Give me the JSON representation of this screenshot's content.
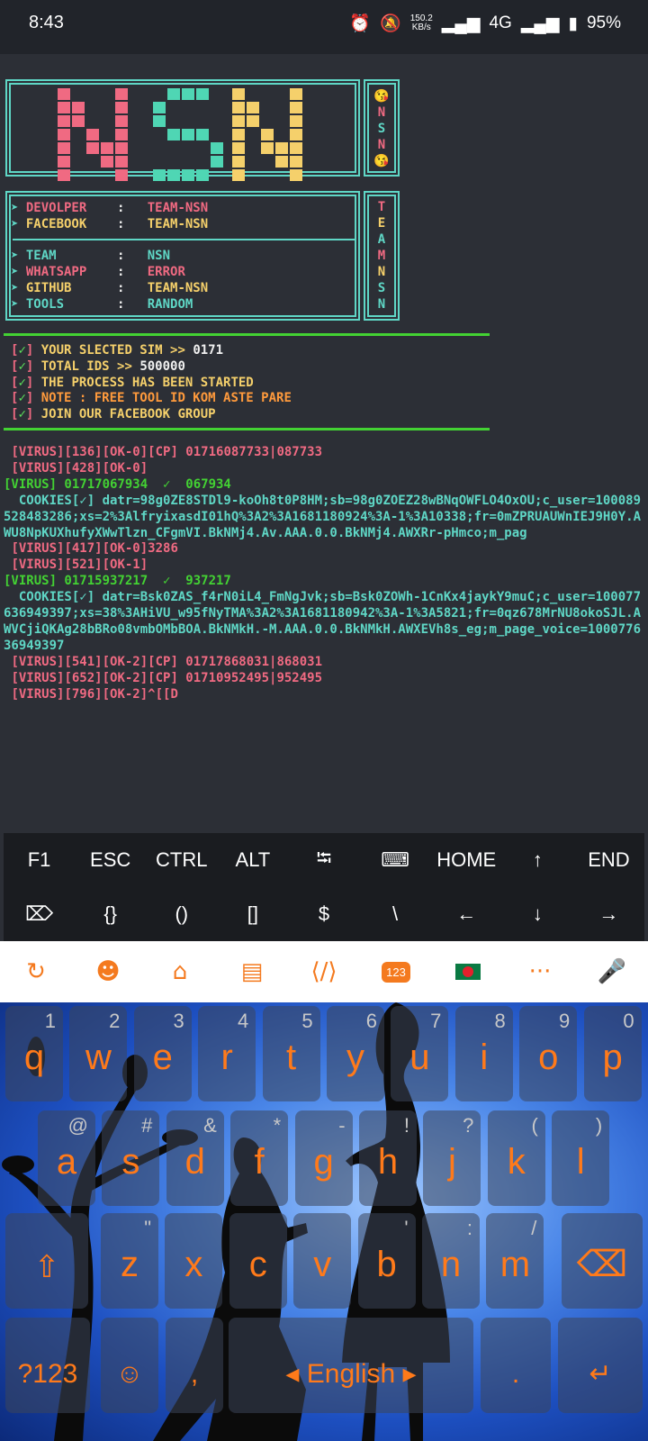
{
  "status_bar": {
    "time": "8:43",
    "net_speed_value": "150.2",
    "net_speed_unit": "KB/s",
    "network": "4G",
    "battery": "95%",
    "icons": [
      "alarm-icon",
      "mute-icon",
      "signal-icon",
      "signal-icon",
      "battery-icon"
    ]
  },
  "logo": {
    "letters": [
      "N",
      "S",
      "N"
    ],
    "colors": [
      "#f06a82",
      "#4fd6b4",
      "#f5d06b"
    ],
    "side": [
      "😘",
      "N",
      "S",
      "N",
      "😘"
    ]
  },
  "info": {
    "rows": [
      {
        "label": "DEVOLPER",
        "value": "TEAM-NSN",
        "label_color": "#f06a82",
        "value_color": "#f06a82"
      },
      {
        "label": "FACEBOOK",
        "value": "TEAM-NSN",
        "label_color": "#f5d06b",
        "value_color": "#f5d06b"
      },
      {
        "label": "TEAM",
        "value": "NSN",
        "label_color": "#5fd7c6",
        "value_color": "#5fd7c6"
      },
      {
        "label": "WHATSAPP",
        "value": "ERROR",
        "label_color": "#f06a82",
        "value_color": "#f06a82"
      },
      {
        "label": "GITHUB",
        "value": "TEAM-NSN",
        "label_color": "#f5d06b",
        "value_color": "#f5d06b"
      },
      {
        "label": "TOOLS",
        "value": "RANDOM",
        "label_color": "#5fd7c6",
        "value_color": "#5fd7c6"
      }
    ],
    "side": [
      "T",
      "E",
      "A",
      "M",
      "N",
      "S",
      "N"
    ]
  },
  "notices": [
    {
      "prefix": "[✓]",
      "text": "YOUR SLECTED SIM >> ",
      "value": "0171",
      "color": "#f5d06b"
    },
    {
      "prefix": "[✓]",
      "text": "TOTAL IDS >> ",
      "value": "500000",
      "color": "#f5d06b"
    },
    {
      "prefix": "[✓]",
      "text": "THE PROCESS HAS BEEN STARTED",
      "value": "",
      "color": "#f5d06b"
    },
    {
      "prefix": "[✓]",
      "text": "NOTE : FREE TOOL ID KOM ASTE PARE",
      "value": "",
      "color": "#ff9a3c"
    },
    {
      "prefix": "[✓]",
      "text": "JOIN OUR FACEBOOK GROUP",
      "value": "",
      "color": "#f5d06b"
    }
  ],
  "output": [
    " [VIRUS][136][OK-0][CP] 01716087733|087733",
    " [VIRUS][428][OK-0]",
    "[VIRUS] 01717067934  ✓  067934",
    "  COOKIES[✓] datr=98g0ZE8STDl9-koOh8t0P8HM;sb=98g0ZOEZ28wBNqOWFLO4OxOU;c_user=100089528483286;xs=2%3AlfryixasdI01hQ%3A2%3A1681180924%3A-1%3A10338;fr=0mZPRUAUWnIEJ9H0Y.AWU8NpKUXhufyXWwTlzn_CFgmVI.BkNMj4.Av.AAA.0.0.BkNMj4.AWXRr-pHmco;m_pag",
    " [VIRUS][417][OK-0]3286",
    " [VIRUS][521][OK-1]",
    "[VIRUS] 01715937217  ✓  937217",
    "  COOKIES[✓] datr=Bsk0ZAS_f4rN0iL4_FmNgJvk;sb=Bsk0ZOWh-1CnKx4jaykY9muC;c_user=100077636949397;xs=38%3AHiVU_w95fNyTMA%3A2%3A1681180942%3A-1%3A5821;fr=0qz678MrNU8okoSJL.AWVCjiQKAg28bBRo08vmbOMbBOA.BkNMkH.-M.AAA.0.0.BkNMkH.AWXEVh8s_eg;m_page_voice=100077636949397",
    " [VIRUS][541][OK-2][CP] 01717868031|868031",
    " [VIRUS][652][OK-2][CP] 01710952495|952495",
    " [VIRUS][796][OK-2]^[[D"
  ],
  "extra_keys": {
    "row1": [
      "F1",
      "ESC",
      "CTRL",
      "ALT",
      "⭾",
      "⌨",
      "HOME",
      "↑",
      "END"
    ],
    "row2": [
      "⌦",
      "{}",
      "()",
      "[]",
      "$",
      "\\",
      "←",
      "↓",
      "→"
    ]
  },
  "keyboard": {
    "toolbar_icons": [
      "translate-icon",
      "emoji-icon",
      "store-icon",
      "clipboard-icon",
      "code-icon",
      "numbers-icon",
      "flag-icon",
      "more-icon",
      "mic-icon"
    ],
    "toolbar_numbers_label": "123",
    "toolbar_more_label": "···",
    "row1": [
      {
        "k": "q",
        "h": "1"
      },
      {
        "k": "w",
        "h": "2"
      },
      {
        "k": "e",
        "h": "3"
      },
      {
        "k": "r",
        "h": "4"
      },
      {
        "k": "t",
        "h": "5"
      },
      {
        "k": "y",
        "h": "6"
      },
      {
        "k": "u",
        "h": "7"
      },
      {
        "k": "i",
        "h": "8"
      },
      {
        "k": "o",
        "h": "9"
      },
      {
        "k": "p",
        "h": "0"
      }
    ],
    "row2": [
      {
        "k": "a",
        "h": "@"
      },
      {
        "k": "s",
        "h": "#"
      },
      {
        "k": "d",
        "h": "&"
      },
      {
        "k": "f",
        "h": "*"
      },
      {
        "k": "g",
        "h": "-"
      },
      {
        "k": "h",
        "h": "!"
      },
      {
        "k": "j",
        "h": "?"
      },
      {
        "k": "k",
        "h": "("
      },
      {
        "k": "l",
        "h": ")"
      }
    ],
    "row3": [
      {
        "k": "⇧",
        "h": ""
      },
      {
        "k": "z",
        "h": "\""
      },
      {
        "k": "x",
        "h": ""
      },
      {
        "k": "c",
        "h": ""
      },
      {
        "k": "v",
        "h": ""
      },
      {
        "k": "b",
        "h": "'"
      },
      {
        "k": "n",
        "h": ":"
      },
      {
        "k": "m",
        "h": "/"
      },
      {
        "k": "⌫",
        "h": ""
      }
    ],
    "row4": [
      {
        "k": "?123",
        "h": ""
      },
      {
        "k": "☺",
        "h": ""
      },
      {
        "k": ",",
        "h": ""
      },
      {
        "k": "◂ English ▸",
        "h": ""
      },
      {
        "k": ".",
        "h": ""
      },
      {
        "k": "↵",
        "h": ""
      }
    ]
  }
}
